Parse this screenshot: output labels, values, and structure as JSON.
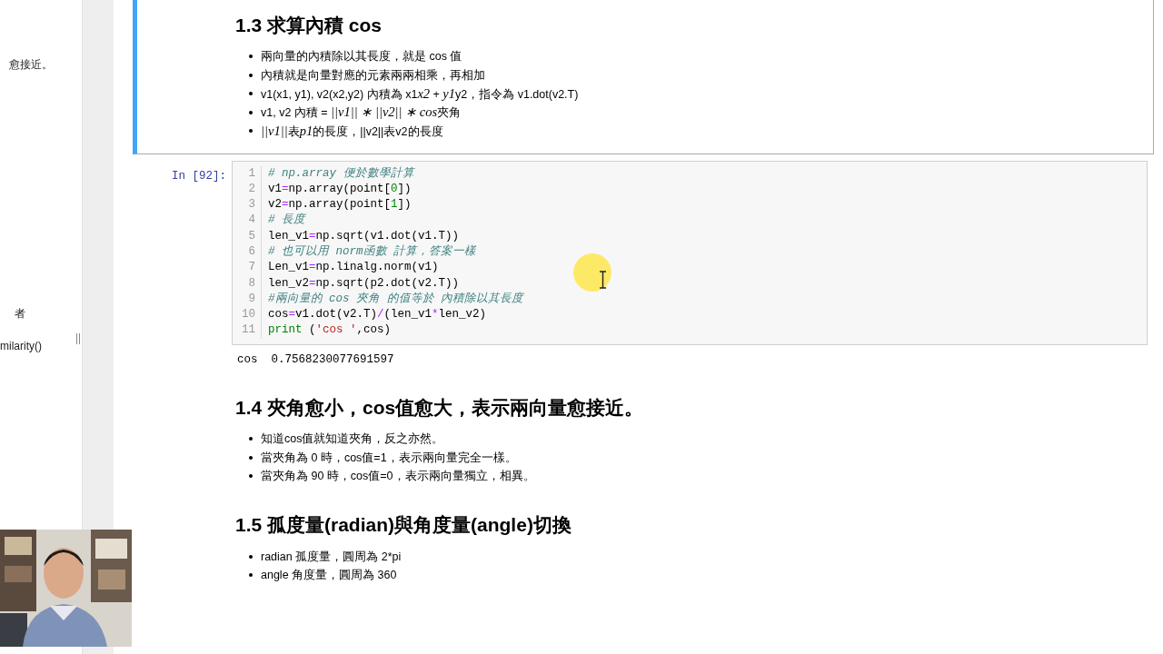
{
  "sidebar": {
    "items": [
      "愈接近。",
      "者",
      "milarity()"
    ]
  },
  "cells": [
    {
      "kind": "markdown",
      "selected": true,
      "heading": "1.3  求算內積 cos",
      "bullets": [
        [
          {
            "text": "兩向量的內積除以其長度，就是 cos 值",
            "math": false
          }
        ],
        [
          {
            "text": "內積就是向量對應的元素兩兩相乘，再相加",
            "math": false
          }
        ],
        [
          {
            "text": "v1(x1, y1), v2(x2,y2) 內積為 x1",
            "math": false
          },
          {
            "text": "x2",
            "math": true
          },
          {
            "text": " + ",
            "math": false
          },
          {
            "text": "y1",
            "math": true
          },
          {
            "text": "y2，指令為 v1.dot(v2.T)",
            "math": false
          }
        ],
        [
          {
            "text": "v1, v2 內積 = ",
            "math": false
          },
          {
            "text": "||v1|| ∗ ||v2|| ∗ cos",
            "math": true
          },
          {
            "text": "夾角",
            "math": false
          }
        ],
        [
          {
            "text": "||v1||",
            "math": true
          },
          {
            "text": "表",
            "math": false
          },
          {
            "text": "p1",
            "math": true
          },
          {
            "text": "的長度，||v2||表v2的長度",
            "math": false
          }
        ]
      ]
    },
    {
      "kind": "code",
      "selected": false,
      "prompt": "In [92]:",
      "lines": [
        {
          "number": "1",
          "tokens": [
            {
              "kind": "comment",
              "text": "# np.array 便於數學計算"
            }
          ]
        },
        {
          "number": "2",
          "tokens": [
            {
              "kind": "plain",
              "text": "v1"
            },
            {
              "kind": "op",
              "text": "="
            },
            {
              "kind": "plain",
              "text": "np.array(point["
            },
            {
              "kind": "number",
              "text": "0"
            },
            {
              "kind": "plain",
              "text": "])"
            }
          ]
        },
        {
          "number": "3",
          "tokens": [
            {
              "kind": "plain",
              "text": "v2"
            },
            {
              "kind": "op",
              "text": "="
            },
            {
              "kind": "plain",
              "text": "np.array(point["
            },
            {
              "kind": "number",
              "text": "1"
            },
            {
              "kind": "plain",
              "text": "])"
            }
          ]
        },
        {
          "number": "4",
          "tokens": [
            {
              "kind": "comment",
              "text": "# 長度"
            }
          ]
        },
        {
          "number": "5",
          "tokens": [
            {
              "kind": "plain",
              "text": "len_v1"
            },
            {
              "kind": "op",
              "text": "="
            },
            {
              "kind": "plain",
              "text": "np.sqrt(v1.dot(v1.T))"
            }
          ]
        },
        {
          "number": "6",
          "tokens": [
            {
              "kind": "comment",
              "text": "# 也可以用 norm函數 計算，答案一樣"
            }
          ]
        },
        {
          "number": "7",
          "tokens": [
            {
              "kind": "plain",
              "text": "Len_v1"
            },
            {
              "kind": "op",
              "text": "="
            },
            {
              "kind": "plain",
              "text": "np.linalg.norm(v1)"
            }
          ]
        },
        {
          "number": "8",
          "tokens": [
            {
              "kind": "plain",
              "text": "len_v2"
            },
            {
              "kind": "op",
              "text": "="
            },
            {
              "kind": "plain",
              "text": "np.sqrt(p2.dot(v2.T))"
            }
          ]
        },
        {
          "number": "9",
          "tokens": [
            {
              "kind": "comment",
              "text": "#兩向量的 cos 夾角 的值等於 內積除以其長度"
            }
          ]
        },
        {
          "number": "10",
          "tokens": [
            {
              "kind": "plain",
              "text": "cos"
            },
            {
              "kind": "op",
              "text": "="
            },
            {
              "kind": "plain",
              "text": "v1.dot(v2.T)"
            },
            {
              "kind": "op",
              "text": "/"
            },
            {
              "kind": "plain",
              "text": "(len_v1"
            },
            {
              "kind": "op",
              "text": "*"
            },
            {
              "kind": "plain",
              "text": "len_v2)"
            }
          ]
        },
        {
          "number": "11",
          "tokens": [
            {
              "kind": "keyword",
              "text": "print"
            },
            {
              "kind": "plain",
              "text": " ("
            },
            {
              "kind": "string",
              "text": "'cos '"
            },
            {
              "kind": "plain",
              "text": ",cos)"
            }
          ]
        }
      ],
      "output": "cos  0.7568230077691597"
    },
    {
      "kind": "markdown",
      "selected": false,
      "heading": "1.4  夾角愈小，cos值愈大，表示兩向量愈接近。",
      "bullets": [
        [
          {
            "text": "知道cos值就知道夾角，反之亦然。",
            "math": false
          }
        ],
        [
          {
            "text": "當夾角為 0 時，cos值=1，表示兩向量完全一樣。",
            "math": false
          }
        ],
        [
          {
            "text": "當夾角為 90 時，cos值=0，表示兩向量獨立，相異。",
            "math": false
          }
        ]
      ]
    },
    {
      "kind": "markdown",
      "selected": false,
      "heading": "1.5  孤度量(radian)與角度量(angle)切換",
      "bullets": [
        [
          {
            "text": "radian 孤度量，圓周為 2*pi",
            "math": false
          }
        ],
        [
          {
            "text": "angle 角度量，圓周為 360",
            "math": false
          }
        ]
      ]
    }
  ]
}
